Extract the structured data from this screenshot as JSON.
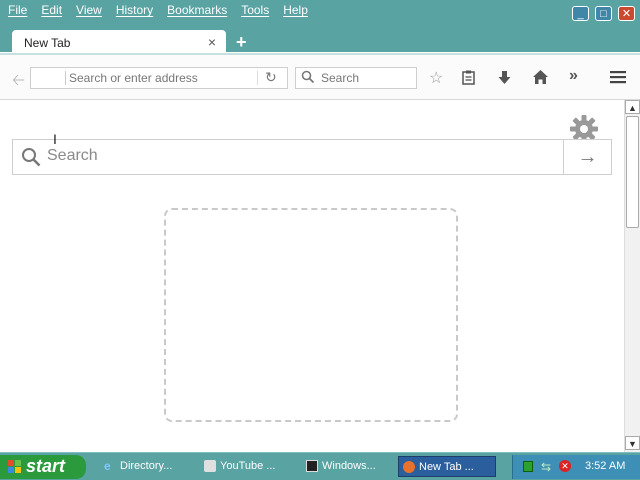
{
  "menu": [
    "File",
    "Edit",
    "View",
    "History",
    "Bookmarks",
    "Tools",
    "Help"
  ],
  "window_buttons": {
    "minimize": "_",
    "maximize": "□",
    "close": "✕"
  },
  "tab": {
    "label": "New Tab",
    "close": "×",
    "new_tab": "+"
  },
  "toolbar": {
    "url_placeholder": "Search or enter address",
    "search_placeholder": "Search",
    "icons": [
      "back-icon",
      "reload-icon",
      "bookmark-star-icon",
      "reading-list-icon",
      "download-icon",
      "home-icon",
      "overflow-icon",
      "hamburger-menu-icon"
    ]
  },
  "content": {
    "search_placeholder": "Search",
    "go": "→"
  },
  "taskbar": {
    "start_label": "start",
    "items": [
      "Directory...",
      "YouTube ...",
      "Windows...",
      "New Tab ..."
    ],
    "clock": "3:52 AM"
  },
  "colors": {
    "titlebar": "#5aa3a3",
    "start_button": "#2a9a3c",
    "active_task": "#2a5e9c"
  }
}
